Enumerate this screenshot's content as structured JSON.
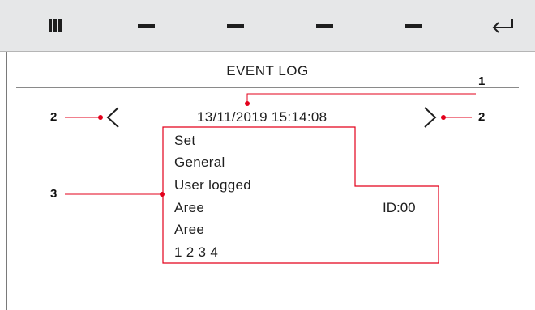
{
  "toolbar": {
    "buttons": [
      {
        "icon": "grid-icon"
      },
      {
        "icon": "dash-icon"
      },
      {
        "icon": "dash-icon"
      },
      {
        "icon": "dash-icon"
      },
      {
        "icon": "dash-icon"
      },
      {
        "icon": "enter-return-icon"
      }
    ]
  },
  "screen": {
    "title": "EVENT LOG",
    "datetime": "13/11/2019 15:14:08",
    "details": {
      "line1": "Set",
      "line2": "General",
      "line3": "User logged",
      "line4": "Aree",
      "line5": "Aree",
      "line6": "1 2 3 4"
    },
    "id_label": "ID:00"
  },
  "callouts": {
    "date": "1",
    "prev": "2",
    "next": "2",
    "details": "3"
  },
  "colors": {
    "callout_red": "#e3001b",
    "toolbar_bg": "#e6e7e8",
    "text": "#1e1e1e"
  }
}
